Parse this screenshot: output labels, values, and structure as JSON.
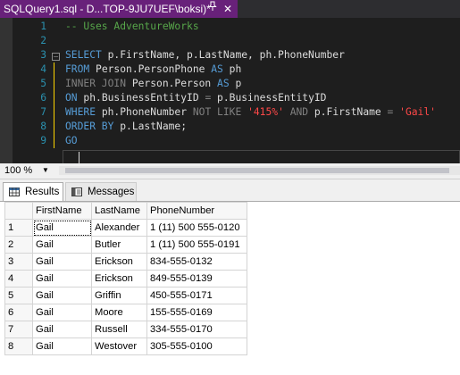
{
  "tab": {
    "title": "SQLQuery1.sql - D...TOP-9JU7UEF\\boksi)*",
    "pin_icon": "pin-icon",
    "close_icon": "close-icon",
    "accent": "#68217a"
  },
  "editor": {
    "line_numbers": [
      "1",
      "2",
      "3",
      "4",
      "5",
      "6",
      "7",
      "8",
      "9"
    ],
    "lines": [
      [
        {
          "t": "-- Uses AdventureWorks",
          "c": "cm"
        }
      ],
      [],
      [
        {
          "t": "SELECT",
          "c": "kw"
        },
        {
          "t": " p.FirstName, p.LastName, ph.PhoneNumber",
          "c": "tx"
        }
      ],
      [
        {
          "t": "FROM",
          "c": "kw"
        },
        {
          "t": " Person.PersonPhone ",
          "c": "tx"
        },
        {
          "t": "AS",
          "c": "kw"
        },
        {
          "t": " ph",
          "c": "tx"
        }
      ],
      [
        {
          "t": "INNER JOIN",
          "c": "gr"
        },
        {
          "t": " Person.Person ",
          "c": "tx"
        },
        {
          "t": "AS",
          "c": "kw"
        },
        {
          "t": " p",
          "c": "tx"
        }
      ],
      [
        {
          "t": "ON",
          "c": "kw"
        },
        {
          "t": " ph.BusinessEntityID ",
          "c": "tx"
        },
        {
          "t": "=",
          "c": "gr"
        },
        {
          "t": " p.BusinessEntityID",
          "c": "tx"
        }
      ],
      [
        {
          "t": "WHERE",
          "c": "kw"
        },
        {
          "t": " ph.PhoneNumber ",
          "c": "tx"
        },
        {
          "t": "NOT LIKE",
          "c": "gr"
        },
        {
          "t": " ",
          "c": "tx"
        },
        {
          "t": "'415%'",
          "c": "str"
        },
        {
          "t": " ",
          "c": "tx"
        },
        {
          "t": "AND",
          "c": "gr"
        },
        {
          "t": " p.FirstName ",
          "c": "tx"
        },
        {
          "t": "=",
          "c": "gr"
        },
        {
          "t": " ",
          "c": "tx"
        },
        {
          "t": "'Gail'",
          "c": "str"
        }
      ],
      [
        {
          "t": "ORDER BY",
          "c": "kw"
        },
        {
          "t": " p.LastName;",
          "c": "tx"
        }
      ],
      [
        {
          "t": "GO",
          "c": "kw"
        }
      ]
    ],
    "colors": {
      "keyword": "#569cd6",
      "comment": "#57a64a",
      "string": "#ff4848",
      "operator": "#808080",
      "text": "#dcdcdc",
      "line_number": "#2b91af"
    }
  },
  "zoom": {
    "value": "100 %"
  },
  "results_tabs": [
    {
      "label": "Results",
      "icon": "grid-icon",
      "active": true
    },
    {
      "label": "Messages",
      "icon": "messages-icon",
      "active": false
    }
  ],
  "grid": {
    "columns": [
      "",
      "FirstName",
      "LastName",
      "PhoneNumber"
    ],
    "rows": [
      [
        "1",
        "Gail",
        "Alexander",
        "1 (11) 500 555-0120"
      ],
      [
        "2",
        "Gail",
        "Butler",
        "1 (11) 500 555-0191"
      ],
      [
        "3",
        "Gail",
        "Erickson",
        "834-555-0132"
      ],
      [
        "4",
        "Gail",
        "Erickson",
        "849-555-0139"
      ],
      [
        "5",
        "Gail",
        "Griffin",
        "450-555-0171"
      ],
      [
        "6",
        "Gail",
        "Moore",
        "155-555-0169"
      ],
      [
        "7",
        "Gail",
        "Russell",
        "334-555-0170"
      ],
      [
        "8",
        "Gail",
        "Westover",
        "305-555-0100"
      ]
    ]
  }
}
